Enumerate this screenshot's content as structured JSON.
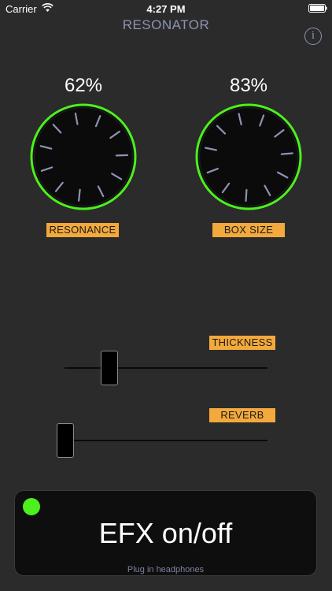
{
  "status_bar": {
    "carrier": "Carrier",
    "time": "4:27 PM"
  },
  "app": {
    "title": "RESONATOR",
    "info_icon": "i"
  },
  "knobs": [
    {
      "label": "RESONANCE",
      "value_text": "62%",
      "value": 0.62
    },
    {
      "label": "BOX SIZE",
      "value_text": "83%",
      "value": 0.83
    }
  ],
  "sliders": [
    {
      "label": "THICKNESS",
      "value": 0.3
    },
    {
      "label": "REVERB",
      "value": 0.0
    }
  ],
  "efx": {
    "label": "EFX on/off",
    "hint": "Plug in headphones",
    "led_on": true
  },
  "colors": {
    "background": "#2b2b2b",
    "accent_label": "#f3a93b",
    "knob_ring": "#4cf01c",
    "tick": "#8e93b4",
    "title": "#8e93b4",
    "led": "#4cf01c"
  },
  "icons": {
    "wifi": "wifi-icon",
    "battery": "battery-icon",
    "info": "info-icon"
  }
}
